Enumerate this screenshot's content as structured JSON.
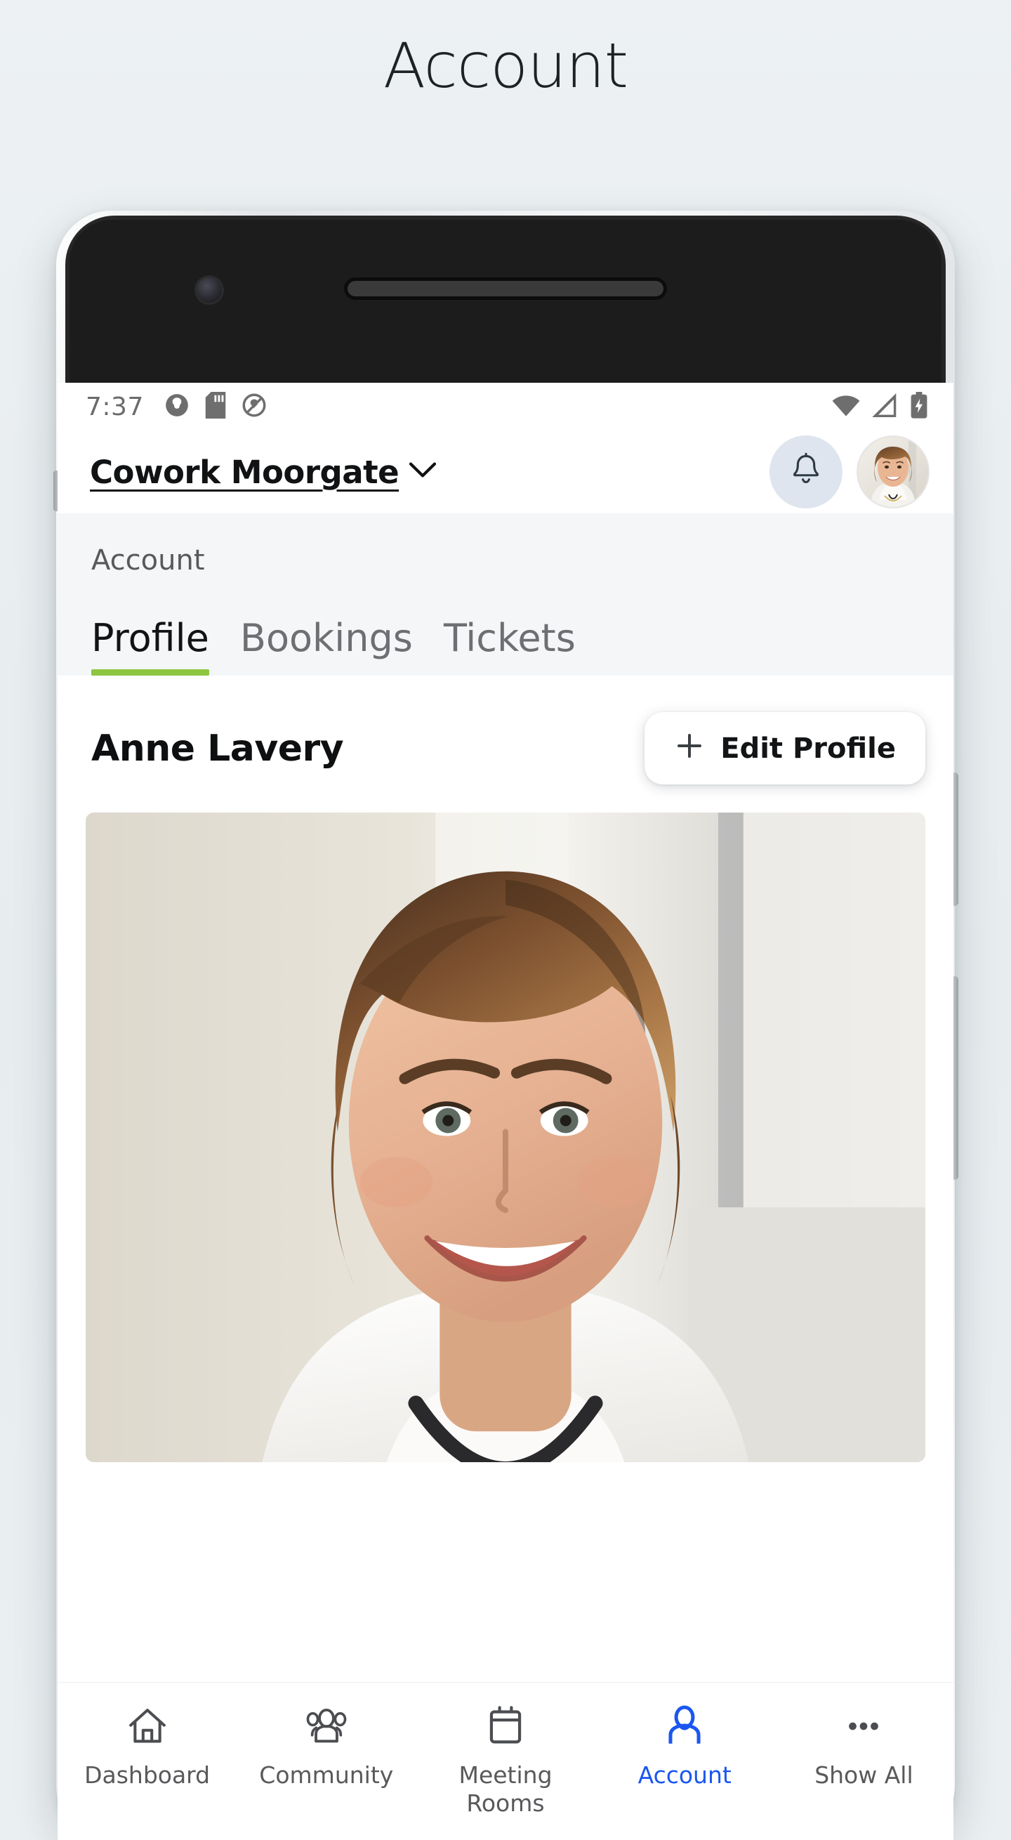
{
  "page": {
    "title": "Account"
  },
  "status_bar": {
    "time": "7:37",
    "left_icons": [
      "app-circle-icon",
      "sd-card-icon",
      "circle-q-icon"
    ],
    "right_icons": [
      "wifi-icon",
      "cellular-signal-icon",
      "battery-charging-icon"
    ]
  },
  "app_header": {
    "venue_name": "Cowork Moorgate",
    "venue_chevron": "chevron-down-icon",
    "notifications_icon": "bell-icon",
    "avatar_alt": "Anne Lavery"
  },
  "section": {
    "label": "Account",
    "tabs": [
      {
        "label": "Profile",
        "active": true
      },
      {
        "label": "Bookings",
        "active": false
      },
      {
        "label": "Tickets",
        "active": false
      }
    ]
  },
  "profile": {
    "name": "Anne Lavery",
    "edit_button": {
      "icon": "plus-icon",
      "label": "Edit Profile"
    },
    "photo_alt": "Anne Lavery profile photo"
  },
  "bottom_nav": {
    "items": [
      {
        "label": "Dashboard",
        "icon": "home-icon",
        "active": false
      },
      {
        "label": "Community",
        "icon": "people-icon",
        "active": false
      },
      {
        "label": "Meeting\nRooms",
        "icon": "calendar-icon",
        "active": false
      },
      {
        "label": "Account",
        "icon": "person-icon",
        "active": true
      },
      {
        "label": "Show All",
        "icon": "more-icon",
        "active": false
      }
    ]
  },
  "colors": {
    "accent_green": "#8ec63f",
    "active_blue": "#1a56f0",
    "backdrop": "#eaeff1",
    "section_bg": "#f4f6f8",
    "bell_bg": "#dfe5ef"
  }
}
